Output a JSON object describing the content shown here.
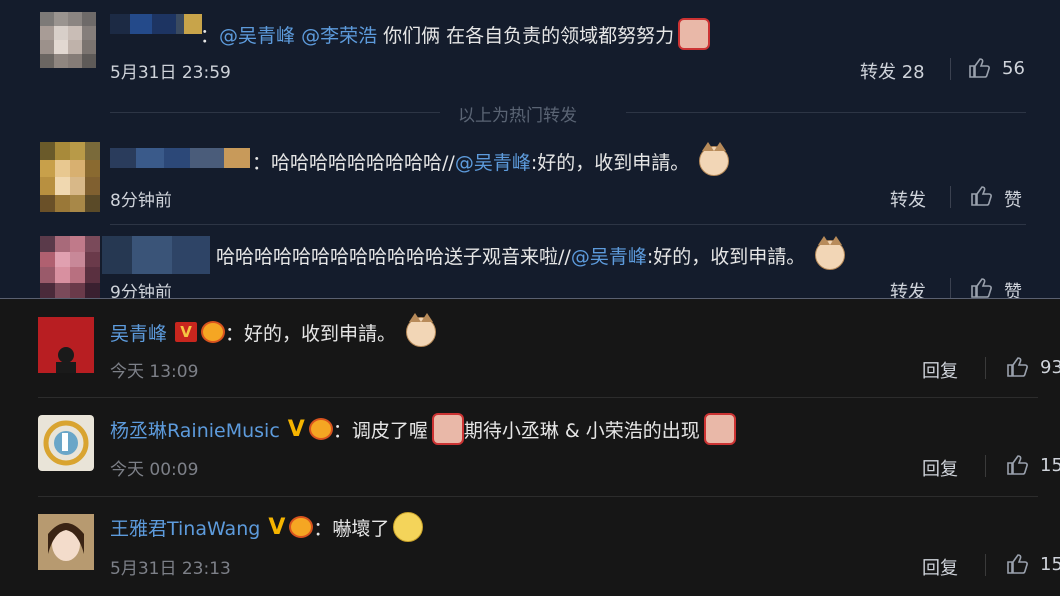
{
  "top": {
    "hot_label": "以上为热门转发",
    "items": [
      {
        "prefix": "：",
        "mention1": "@吴青峰",
        "mention2": "@李荣浩",
        "text": "你们俩 在各自负责的领域都努努力",
        "time": "5月31日 23:59",
        "repost_label": "转发 28",
        "like_count": "56"
      },
      {
        "prefix": "：",
        "text1": "哈哈哈哈哈哈哈哈哈//",
        "mention": "@吴青峰",
        "text2": ":好的，收到申請。",
        "time": "8分钟前",
        "repost_label": "转发",
        "like_label": "赞"
      },
      {
        "text1": "哈哈哈哈哈哈哈哈哈哈哈哈送子观音来啦//",
        "mention": "@吴青峰",
        "text2": ":好的，收到申請。",
        "time": "9分钟前",
        "repost_label": "转发",
        "like_label": "赞"
      }
    ]
  },
  "bottom": {
    "items": [
      {
        "name": "吴青峰",
        "badge": "V",
        "text": "：好的，收到申請。",
        "time": "今天 13:09",
        "reply_label": "回复",
        "like_count": "93"
      },
      {
        "name": "杨丞琳RainieMusic",
        "badge": "V",
        "text1": "：调皮了喔",
        "text2": " 期待小丞琳 & 小荣浩的出现",
        "time": "今天 00:09",
        "reply_label": "回复",
        "like_count": "15"
      },
      {
        "name": "王雅君TinaWang",
        "badge": "V",
        "text": "：嚇壞了",
        "time": "5月31日 23:13",
        "reply_label": "回复",
        "like_count": "15"
      }
    ]
  },
  "colors": {
    "link": "#5d9bdc",
    "top_bg": "#141c2c",
    "bottom_bg": "#161616"
  }
}
